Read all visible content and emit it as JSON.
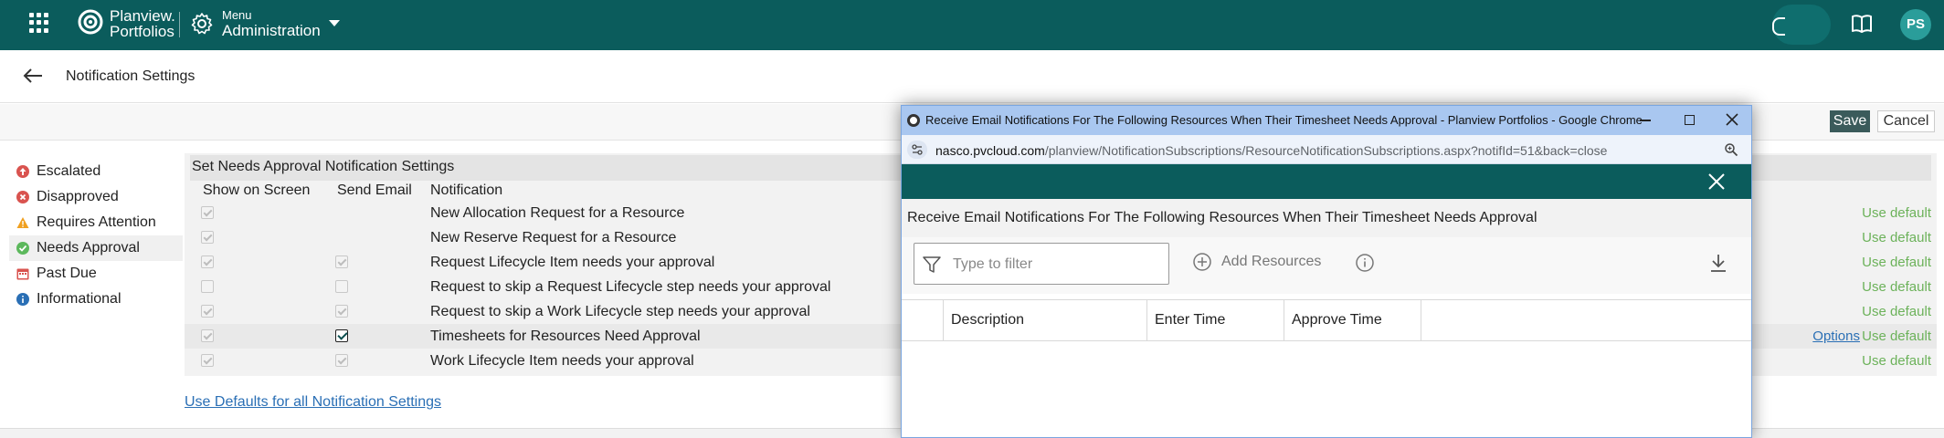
{
  "topbar": {
    "brand_line1": "Planview.",
    "brand_line2": "Portfolios",
    "menu_small": "Menu",
    "menu_big": "Administration",
    "avatar_initials": "PS"
  },
  "page": {
    "title": "Notification Settings",
    "save_label": "Save",
    "cancel_label": "Cancel"
  },
  "sidebar": {
    "items": [
      {
        "label": "Escalated",
        "icon": "arrow-up-circle-icon",
        "color": "#d9534f"
      },
      {
        "label": "Disapproved",
        "icon": "x-circle-icon",
        "color": "#d9534f"
      },
      {
        "label": "Requires Attention",
        "icon": "warning-triangle-icon",
        "color": "#f0a020"
      },
      {
        "label": "Needs Approval",
        "icon": "check-circle-icon",
        "color": "#5cb85c"
      },
      {
        "label": "Past Due",
        "icon": "calendar-icon",
        "color": "#d9534f"
      },
      {
        "label": "Informational",
        "icon": "info-circle-icon",
        "color": "#2a6fb5"
      }
    ]
  },
  "settings": {
    "section_title": "Set Needs Approval Notification Settings",
    "headers": {
      "show": "Show on Screen",
      "email": "Send Email",
      "notification": "Notification"
    },
    "rows": [
      {
        "label": "New Allocation Request for a Resource",
        "show": "disabled-checked",
        "email": "none",
        "default": "Use default",
        "options": ""
      },
      {
        "label": "New Reserve Request for a Resource",
        "show": "disabled-checked",
        "email": "none",
        "default": "Use default",
        "options": ""
      },
      {
        "label": "Request Lifecycle Item needs your approval",
        "show": "disabled-checked",
        "email": "disabled-checked",
        "default": "Use default",
        "options": ""
      },
      {
        "label": "Request to skip a Request Lifecycle step needs your approval",
        "show": "disabled-unchecked",
        "email": "disabled-unchecked",
        "default": "Use default",
        "options": ""
      },
      {
        "label": "Request to skip a Work Lifecycle step needs your approval",
        "show": "disabled-checked",
        "email": "disabled-checked",
        "default": "Use default",
        "options": ""
      },
      {
        "label": "Timesheets for Resources Need Approval",
        "show": "disabled-checked",
        "email": "checked",
        "default": "Use default",
        "options": "Options"
      },
      {
        "label": "Work Lifecycle Item needs your approval",
        "show": "disabled-checked",
        "email": "disabled-checked",
        "default": "Use default",
        "options": ""
      }
    ],
    "defaults_link": "Use Defaults for all Notification Settings"
  },
  "popup": {
    "window_title": "Receive Email Notifications For The Following Resources When Their Timesheet Needs Approval - Planview Portfolios - Google Chrome",
    "url_host": "nasco.pvcloud.com",
    "url_path": "/planview/NotificationSubscriptions/ResourceNotificationSubscriptions.aspx?notifId=51&back=close",
    "heading": "Receive Email Notifications For The Following Resources When Their Timesheet Needs Approval",
    "filter_placeholder": "Type to filter",
    "add_resources": "Add Resources",
    "columns": [
      "Description",
      "Enter Time",
      "Approve Time"
    ]
  },
  "colors": {
    "brand_teal": "#0b5c5c",
    "use_default_green": "#6cb25a",
    "link_blue": "#2a6fb5"
  }
}
